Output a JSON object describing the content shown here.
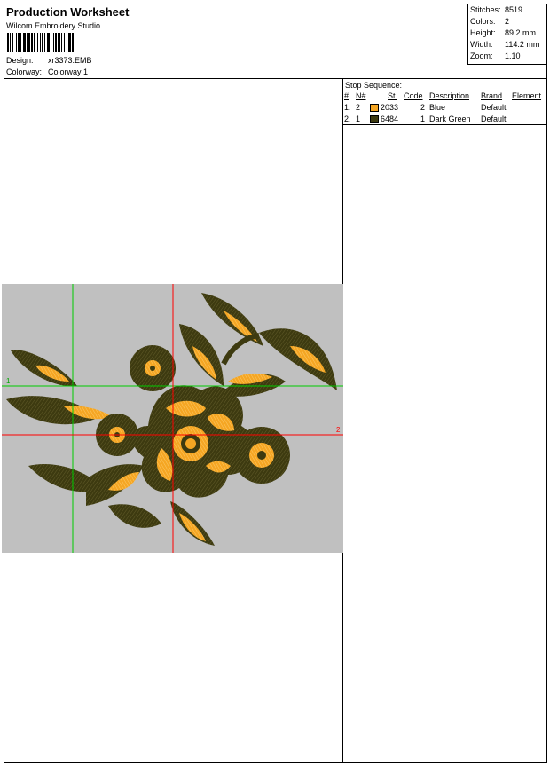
{
  "header": {
    "title": "Production Worksheet",
    "software": "Wilcom Embroidery Studio",
    "design_label": "Design:",
    "design_value": "xr3373.EMB",
    "colorway_label": "Colorway:",
    "colorway_value": "Colorway 1"
  },
  "stats": {
    "stitches_label": "Stitches:",
    "stitches_value": "8519",
    "colors_label": "Colors:",
    "colors_value": "2",
    "height_label": "Height:",
    "height_value": "89.2 mm",
    "width_label": "Width:",
    "width_value": "114.2 mm",
    "zoom_label": "Zoom:",
    "zoom_value": "1.10"
  },
  "stop_sequence": {
    "title": "Stop Sequence:",
    "columns": [
      "#",
      "N#",
      "St.",
      "Code",
      "Description",
      "Brand",
      "Element"
    ],
    "rows": [
      {
        "num": "1.",
        "n": "2",
        "st": "2033",
        "code": "2",
        "description": "Blue",
        "brand": "Default",
        "color": "#f5a623"
      },
      {
        "num": "2.",
        "n": "1",
        "st": "6484",
        "code": "1",
        "description": "Dark Green",
        "brand": "Default",
        "color": "#3d3a10"
      }
    ]
  },
  "canvas": {
    "background": "#c0c0c0",
    "guide_green": "#00cc00",
    "guide_red": "#ff0000",
    "guide_green_label": "1",
    "guide_red_label": "2",
    "thread_dark": "#3d3a10",
    "thread_orange": "#f5a623"
  }
}
